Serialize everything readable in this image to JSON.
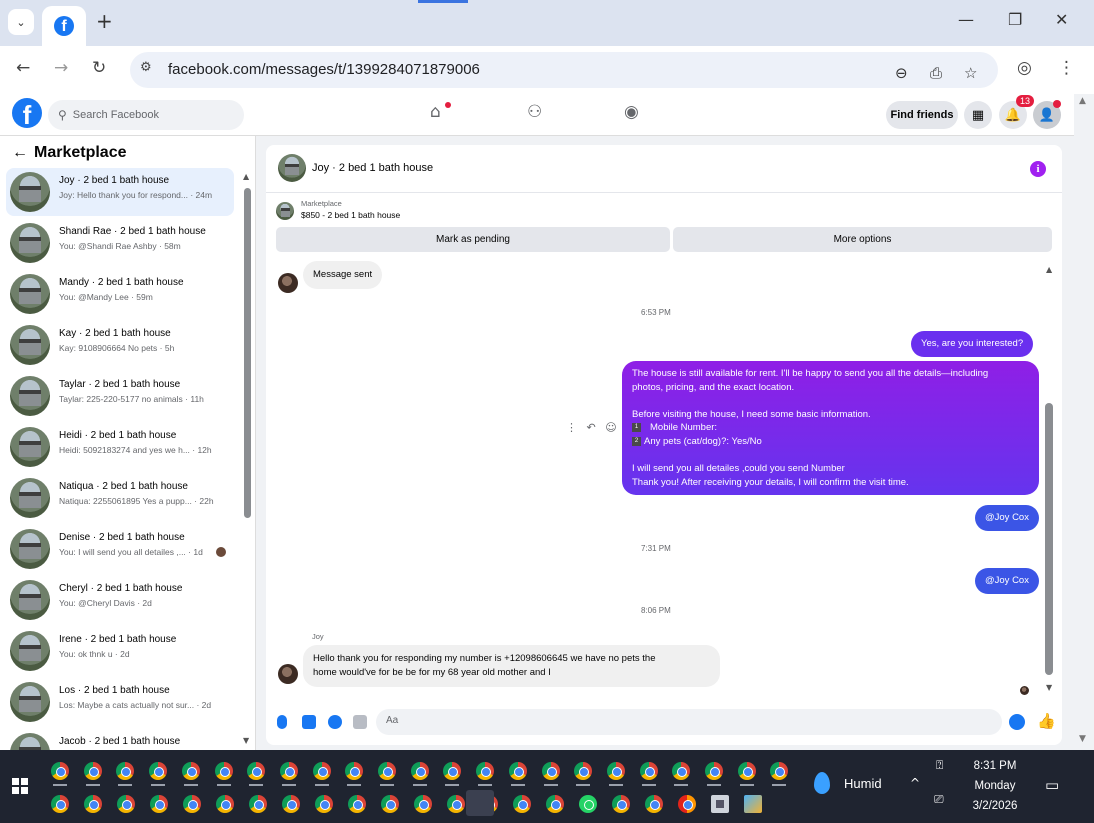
{
  "browser": {
    "url": "facebook.com/messages/t/1399284071879006"
  },
  "fb": {
    "logo": "f",
    "search_placeholder": "Search Facebook",
    "find_friends": "Find friends",
    "notif_count": "13"
  },
  "sidebar": {
    "title": "Marketplace",
    "conversations": [
      {
        "name": "Joy · 2 bed 1 bath house",
        "preview": "Joy: Hello thank you for respond... · 24m"
      },
      {
        "name": "Shandi Rae · 2 bed 1 bath house",
        "preview": "You: @Shandi Rae Ashby · 58m"
      },
      {
        "name": "Mandy · 2 bed 1 bath house",
        "preview": "You: @Mandy Lee · 59m"
      },
      {
        "name": "Kay · 2 bed 1 bath house",
        "preview": "Kay: 9108906664 No pets · 5h"
      },
      {
        "name": "Taylar · 2 bed 1 bath house",
        "preview": "Taylar: 225-220-5177 no animals · 11h"
      },
      {
        "name": "Heidi · 2 bed 1 bath house",
        "preview": "Heidi: 5092183274 and yes we h... · 12h"
      },
      {
        "name": "Natiqua · 2 bed 1 bath house",
        "preview": "Natiqua: 2255061895 Yes a pupp... · 22h"
      },
      {
        "name": "Denise · 2 bed 1 bath house",
        "preview": "You: I will send you all detailes ,... · 1d"
      },
      {
        "name": "Cheryl · 2 bed 1 bath house",
        "preview": "You: @Cheryl Davis · 2d"
      },
      {
        "name": "Irene · 2 bed 1 bath house",
        "preview": "You: ok thnk u · 2d"
      },
      {
        "name": "Los · 2 bed 1 bath house",
        "preview": "Los: Maybe a cats actually not sur... · 2d"
      },
      {
        "name": "Jacob · 2 bed 1 bath house",
        "preview": ""
      }
    ]
  },
  "chat": {
    "title": "Joy · 2 bed 1 bath house",
    "marketplace_label": "Marketplace",
    "listing": "$850 - 2 bed 1 bath house",
    "mark_pending": "Mark as pending",
    "more_options": "More options",
    "msg_sent": "Message sent",
    "ts1": "6:53 PM",
    "out1": "Yes, are you interested?",
    "long": {
      "l1": "The house is still available for rent. I'll be happy to send you all the details—including",
      "l2": "photos, pricing, and the exact location.",
      "l3": "Before visiting the house, I need some basic information.",
      "n1": "1",
      "l4": "Mobile Number:",
      "n2": "2",
      "l5": "Any pets (cat/dog)?: Yes/No",
      "l6": "I will send you all detailes ,could you send Number",
      "l7": "Thank you! After receiving your details, I will confirm the visit time."
    },
    "mention1": "@Joy Cox",
    "ts2": "7:31 PM",
    "mention2": "@Joy Cox",
    "ts3": "8:06 PM",
    "sender": "Joy",
    "in_l1": "Hello thank you for responding my number is +12098606645 we have no pets the",
    "in_l2": "home would've for be be for my 68 year old mother and I",
    "composer_placeholder": "Aa"
  },
  "taskbar": {
    "weather": "Humid",
    "time": "8:31 PM",
    "day": "Monday",
    "date": "3/2/2026"
  }
}
